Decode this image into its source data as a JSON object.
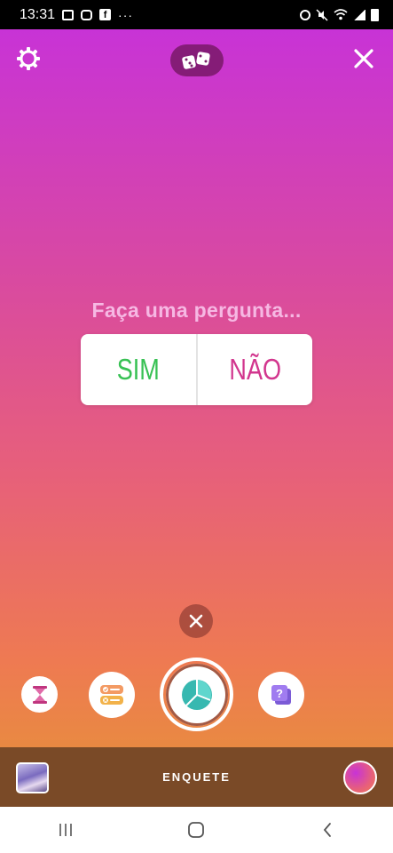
{
  "status_bar": {
    "time": "13:31",
    "left_icons": [
      "gallery-icon",
      "instagram-icon",
      "facebook-icon",
      "more-icon"
    ],
    "right_icons": [
      "alarm-icon",
      "mute-icon",
      "wifi-icon",
      "signal-icon",
      "battery-icon"
    ],
    "more_label": "···"
  },
  "top_bar": {
    "left_icon": "gear-icon",
    "center_icon": "dice-icon",
    "right_icon": "close-icon"
  },
  "poll": {
    "question_placeholder": "Faça uma pergunta...",
    "option_yes": "SIM",
    "option_no": "NÃO",
    "colors": {
      "yes": "#38c154",
      "no": "#d2368e"
    }
  },
  "tools": [
    "countdown-icon",
    "quiz-icon",
    "poll-icon",
    "questions-icon"
  ],
  "mode_bar": {
    "label": "ENQUETE"
  },
  "background_gradient": [
    "#c833d6",
    "#d94aa0",
    "#e7607a",
    "#ee7a52"
  ],
  "nav": [
    "recent-apps-icon",
    "home-icon",
    "back-icon"
  ]
}
